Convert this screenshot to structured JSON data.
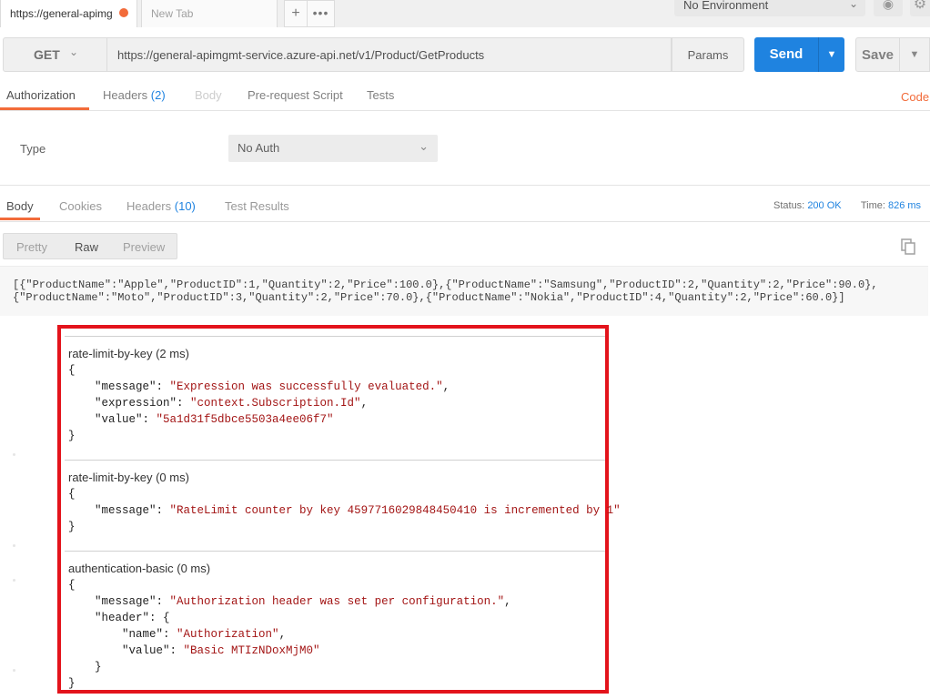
{
  "tabs": {
    "active_label": "https://general-apimg",
    "new_tab_label": "New Tab",
    "plus_label": "+",
    "more_label": "•••"
  },
  "environment": {
    "selected": "No Environment"
  },
  "request": {
    "method": "GET",
    "url": "https://general-apimgmt-service.azure-api.net/v1/Product/GetProducts",
    "params_label": "Params",
    "send_label": "Send",
    "save_label": "Save"
  },
  "request_tabs": {
    "authorization": "Authorization",
    "headers": "Headers",
    "headers_count": "(2)",
    "body": "Body",
    "prerequest": "Pre-request Script",
    "tests": "Tests",
    "code": "Code"
  },
  "auth": {
    "type_label": "Type",
    "selected": "No Auth"
  },
  "response_tabs": {
    "body": "Body",
    "cookies": "Cookies",
    "headers": "Headers",
    "headers_count": "(10)",
    "test_results": "Test Results"
  },
  "status": {
    "status_label": "Status:",
    "status_value": "200 OK",
    "time_label": "Time:",
    "time_value": "826 ms"
  },
  "view_modes": {
    "pretty": "Pretty",
    "raw": "Raw",
    "preview": "Preview"
  },
  "response_body": {
    "line1": "[{\"ProductName\":\"Apple\",\"ProductID\":1,\"Quantity\":2,\"Price\":100.0},{\"ProductName\":\"Samsung\",\"ProductID\":2,\"Quantity\":2,\"Price\":90.0},",
    "line2": "{\"ProductName\":\"Moto\",\"ProductID\":3,\"Quantity\":2,\"Price\":70.0},{\"ProductName\":\"Nokia\",\"ProductID\":4,\"Quantity\":2,\"Price\":60.0}]"
  },
  "trace": {
    "block1": {
      "title": "rate-limit-by-key (2 ms)",
      "open": "{",
      "k1": "\"message\"",
      "v1": "\"Expression was successfully evaluated.\"",
      "k2": "\"expression\"",
      "v2": "\"context.Subscription.Id\"",
      "k3": "\"value\"",
      "v3": "\"5a1d31f5dbce5503a4ee06f7\"",
      "close": "}"
    },
    "block2": {
      "title": "rate-limit-by-key (0 ms)",
      "open": "{",
      "k1": "\"message\"",
      "v1": "\"RateLimit counter by key 4597716029848450410 is incremented by 1\"",
      "close": "}"
    },
    "block3": {
      "title": "authentication-basic (0 ms)",
      "open": "{",
      "k1": "\"message\"",
      "v1": "\"Authorization header was set per configuration.\"",
      "k2": "\"header\"",
      "k3": "\"name\"",
      "v3": "\"Authorization\"",
      "k4": "\"value\"",
      "v4": "\"Basic MTIzNDoxMjM0\"",
      "inner_close": "}",
      "close": "}"
    }
  },
  "colors": {
    "accent": "#f26b3a",
    "primary": "#1f83e0",
    "highlight_border": "#e3131b",
    "string": "#a31515"
  }
}
